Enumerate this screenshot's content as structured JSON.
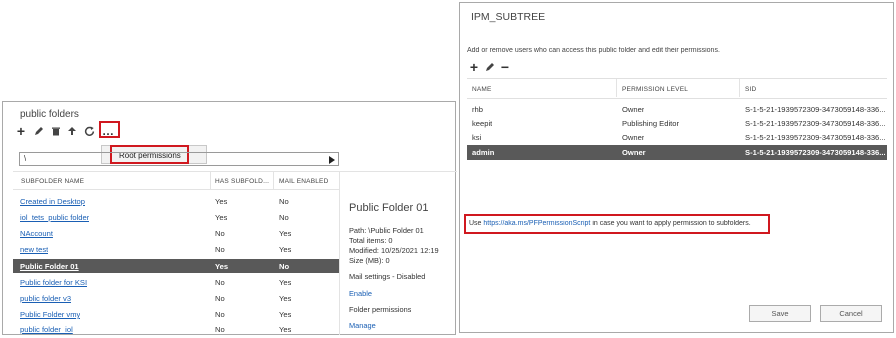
{
  "left": {
    "title": "public folders",
    "path_value": "\\",
    "menu_item": "Root permissions",
    "columns": [
      "SUBFOLDER NAME",
      "HAS SUBFOLD...",
      "MAIL ENABLED"
    ],
    "rows": [
      {
        "name": "Created in Desktop",
        "has": "Yes",
        "mail": "No"
      },
      {
        "name": "iol_tets_public folder",
        "has": "Yes",
        "mail": "No"
      },
      {
        "name": "NAccount",
        "has": "No",
        "mail": "Yes"
      },
      {
        "name": "new test",
        "has": "No",
        "mail": "Yes"
      },
      {
        "name": "Public Folder 01",
        "has": "Yes",
        "mail": "No"
      },
      {
        "name": "Public folder for KSI",
        "has": "No",
        "mail": "Yes"
      },
      {
        "name": "public folder v3",
        "has": "No",
        "mail": "Yes"
      },
      {
        "name": "Public Folder vmy",
        "has": "No",
        "mail": "Yes"
      },
      {
        "name": "public folder_iol",
        "has": "No",
        "mail": "Yes"
      }
    ],
    "detail": {
      "title": "Public Folder 01",
      "path": "Path: \\Public Folder 01",
      "total": "Total items: 0",
      "modified": "Modified: 10/25/2021 12:19",
      "size": "Size (MB): 0",
      "mail_settings": "Mail settings - Disabled",
      "enable": "Enable",
      "folder_permissions": "Folder permissions",
      "manage": "Manage"
    }
  },
  "right": {
    "title": "IPM_SUBTREE",
    "description": "Add or remove users who can access this public folder and edit their permissions.",
    "columns": [
      "NAME",
      "PERMISSION LEVEL",
      "SID"
    ],
    "rows": [
      {
        "name": "rhb",
        "level": "Owner",
        "sid": "S-1-5-21-1939572309-3473059148-336..."
      },
      {
        "name": "keepit",
        "level": "Publishing Editor",
        "sid": "S-1-5-21-1939572309-3473059148-336..."
      },
      {
        "name": "ksi",
        "level": "Owner",
        "sid": "S-1-5-21-1939572309-3473059148-336..."
      },
      {
        "name": "admin",
        "level": "Owner",
        "sid": "S-1-5-21-1939572309-3473059148-336..."
      }
    ],
    "note_prefix": "Use ",
    "note_link": "https://aka.ms/PFPermissionScript",
    "note_suffix": " in case you want to apply permission to subfolders.",
    "save": "Save",
    "cancel": "Cancel"
  },
  "colors": {
    "accent_red": "#d0181f",
    "link_blue": "#1a5fb4",
    "selected_row": "#595959"
  }
}
